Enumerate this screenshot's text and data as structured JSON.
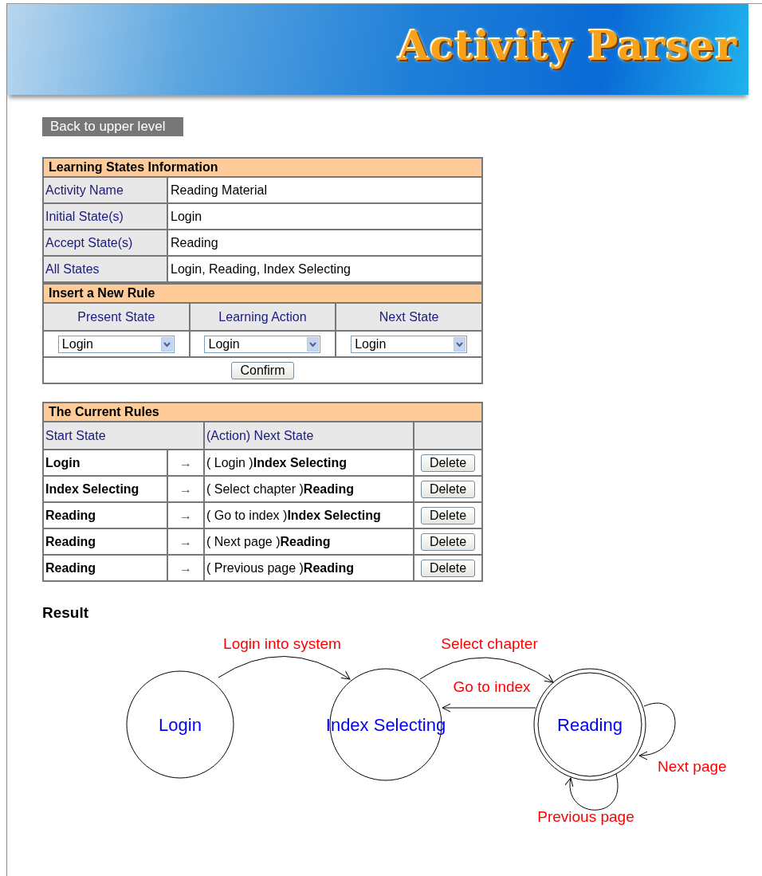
{
  "banner": {
    "title": "Activity Parser"
  },
  "back_button": {
    "label": "Back to upper level"
  },
  "info": {
    "title": "Learning States Information",
    "rows": [
      {
        "label": "Activity Name",
        "value": "Reading Material"
      },
      {
        "label": "Initial State(s)",
        "value": "Login"
      },
      {
        "label": "Accept State(s)",
        "value": "Reading"
      },
      {
        "label": "All States",
        "value": "Login, Reading, Index Selecting"
      }
    ]
  },
  "new_rule": {
    "title": "Insert a New Rule",
    "columns": [
      "Present State",
      "Learning Action",
      "Next State"
    ],
    "selects": [
      {
        "value": "Login"
      },
      {
        "value": "Login"
      },
      {
        "value": "Login"
      }
    ],
    "confirm": "Confirm"
  },
  "current_rules": {
    "title": "The Current Rules",
    "columns": [
      "Start State",
      "(Action) Next State"
    ],
    "rows": [
      {
        "start": "Login",
        "arrow": "→",
        "result": "( Login )**Index Selecting**",
        "delete": "Delete"
      },
      {
        "start": "Index Selecting",
        "arrow": "→",
        "result": "( Select chapter )**Reading**",
        "delete": "Delete"
      },
      {
        "start": "Reading",
        "arrow": "→",
        "result": "( Go to index )**Index Selecting**",
        "delete": "Delete"
      },
      {
        "start": "Reading",
        "arrow": "→",
        "result": "( Next page )**Reading**",
        "delete": "Delete"
      },
      {
        "start": "Reading",
        "arrow": "→",
        "result": "( Previous page )**Reading**",
        "delete": "Delete"
      }
    ]
  },
  "result": {
    "title": "Result",
    "states": [
      {
        "name": "Login",
        "accept": false
      },
      {
        "name": "Index Selecting",
        "accept": false
      },
      {
        "name": "Reading",
        "accept": true
      }
    ],
    "transitions": [
      {
        "label": "Login into system"
      },
      {
        "label": "Select chapter"
      },
      {
        "label": "Go to index"
      },
      {
        "label": "Next page"
      },
      {
        "label": "Previous page"
      }
    ]
  }
}
